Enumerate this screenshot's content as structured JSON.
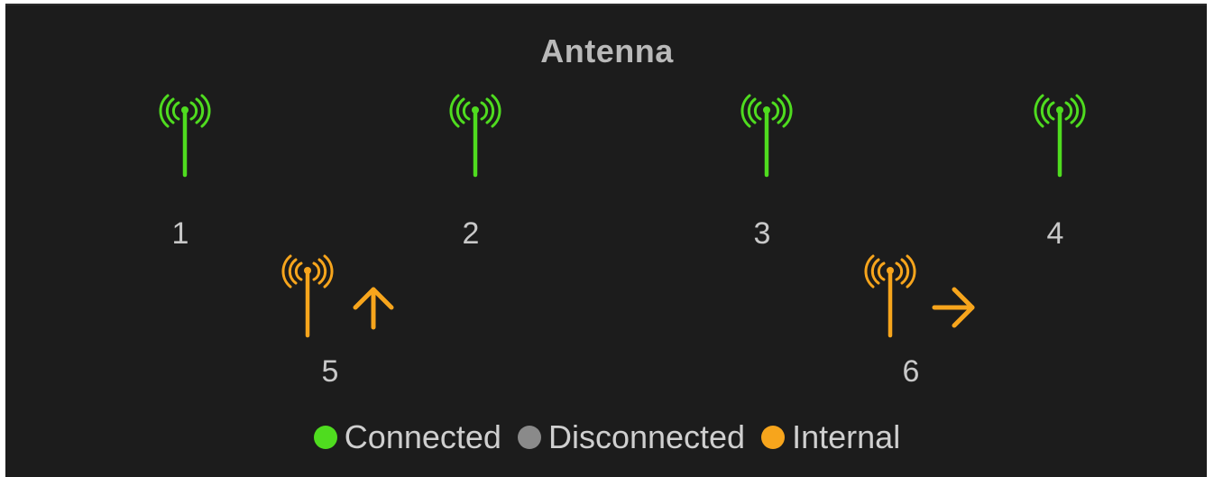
{
  "header": {
    "title": "Antenna"
  },
  "colors": {
    "connected": "#4fdc1f",
    "disconnected": "#8a8a8a",
    "internal": "#f7a51c",
    "background": "#1c1c1c"
  },
  "antennas": [
    {
      "label": "1",
      "status": "connected",
      "icon": "antenna-signal-icon"
    },
    {
      "label": "2",
      "status": "connected",
      "icon": "antenna-signal-icon"
    },
    {
      "label": "3",
      "status": "connected",
      "icon": "antenna-signal-icon"
    },
    {
      "label": "4",
      "status": "connected",
      "icon": "antenna-signal-icon"
    },
    {
      "label": "5",
      "status": "internal",
      "icon": "antenna-signal-icon",
      "direction": "up",
      "direction_icon": "arrow-up-icon"
    },
    {
      "label": "6",
      "status": "internal",
      "icon": "antenna-signal-icon",
      "direction": "right",
      "direction_icon": "arrow-right-icon"
    }
  ],
  "legend": [
    {
      "label": "Connected",
      "status": "connected"
    },
    {
      "label": "Disconnected",
      "status": "disconnected"
    },
    {
      "label": "Internal",
      "status": "internal"
    }
  ]
}
